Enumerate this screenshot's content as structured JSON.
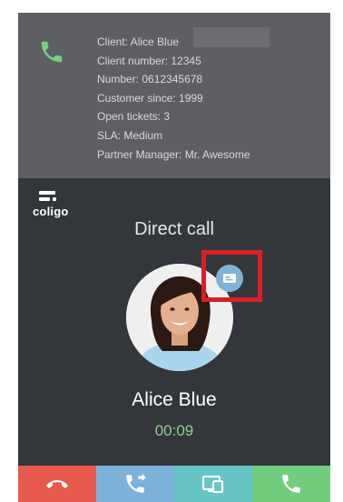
{
  "client_info": {
    "lines": [
      "Client: Alice Blue",
      "Client number: 12345",
      "Number: 0612345678",
      "Customer since: 1999",
      "Open tickets: 3",
      "SLA: Medium",
      "Partner Manager: Mr. Awesome"
    ]
  },
  "logo": {
    "text": "coligo"
  },
  "call": {
    "type": "Direct call",
    "caller_name": "Alice Blue",
    "duration": "00:09"
  },
  "actions": {
    "hangup_icon": "phone-hangup-icon",
    "transfer_icon": "call-transfer-icon",
    "screen_icon": "screen-share-icon",
    "answer_icon": "phone-icon"
  },
  "colors": {
    "hangup": "#e8594e",
    "transfer": "#7cb1d9",
    "screen": "#66c5c5",
    "answer": "#73cd7f",
    "timer": "#8bcf8f",
    "highlight": "#d71f26"
  }
}
